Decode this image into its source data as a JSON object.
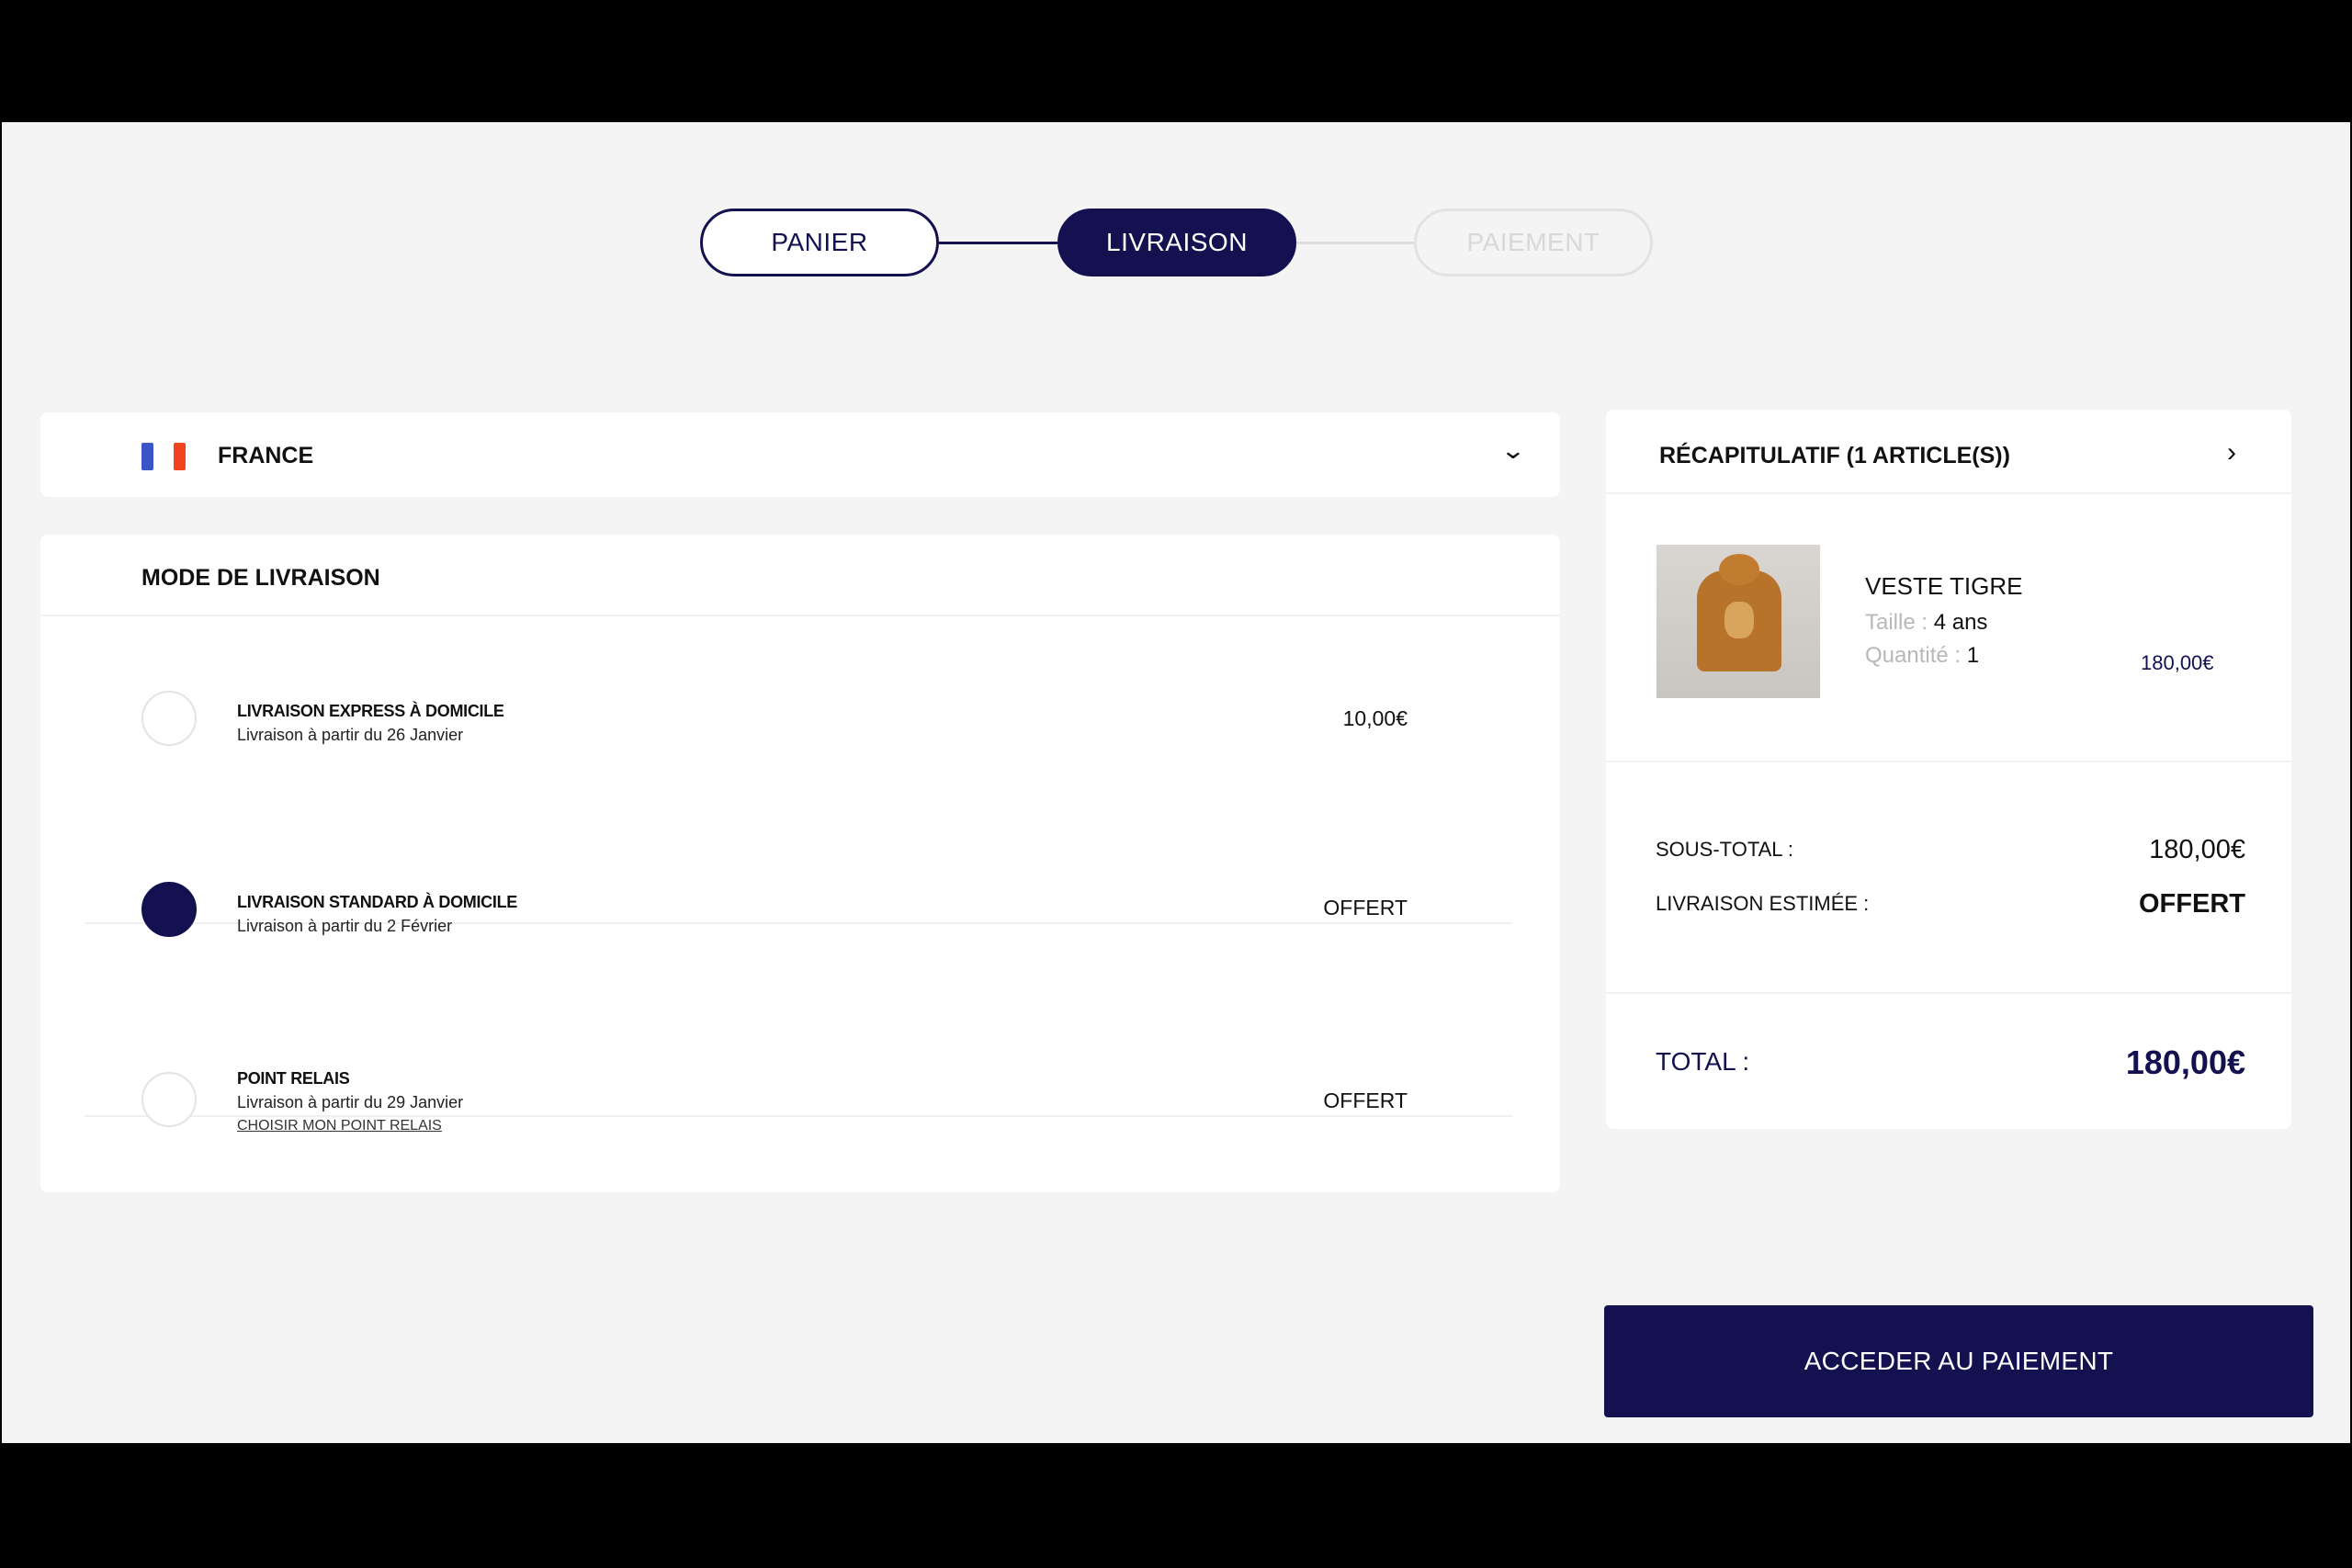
{
  "colors": {
    "accent": "#141150",
    "flag_blue": "#3b54c8",
    "flag_red": "#f0431e"
  },
  "stepper": {
    "steps": [
      {
        "label": "PANIER",
        "state": "done"
      },
      {
        "label": "LIVRAISON",
        "state": "active"
      },
      {
        "label": "PAIEMENT",
        "state": "todo"
      }
    ]
  },
  "country": {
    "name": "FRANCE",
    "flag_icon": "flag-france-icon",
    "toggle_icon": "chevron-down-icon"
  },
  "delivery": {
    "title": "MODE DE LIVRAISON",
    "options": [
      {
        "title": "LIVRAISON EXPRESS À DOMICILE",
        "subtitle": "Livraison à partir du 26 Janvier",
        "price": "10,00€",
        "selected": false
      },
      {
        "title": "LIVRAISON STANDARD À DOMICILE",
        "subtitle": "Livraison à partir du 2 Février",
        "price": "OFFERT",
        "selected": true
      },
      {
        "title": "POINT RELAIS",
        "subtitle": "Livraison à partir du 29 Janvier",
        "link": "CHOISIR MON POINT RELAIS",
        "price": "OFFERT",
        "selected": false
      }
    ]
  },
  "summary": {
    "title": "RÉCAPITULATIF (1 ARTICLE(S))",
    "expand_icon": "chevron-right-icon",
    "product": {
      "name": "VESTE TIGRE",
      "size_label": "Taille :",
      "size_value": "4 ans",
      "qty_label": "Quantité :",
      "qty_value": "1",
      "price": "180,00€"
    },
    "subtotal_label": "SOUS-TOTAL :",
    "subtotal_value": "180,00€",
    "shipping_label": "LIVRAISON ESTIMÉE :",
    "shipping_value": "OFFERT",
    "total_label": "TOTAL :",
    "total_value": "180,00€"
  },
  "pay_button": "ACCEDER AU PAIEMENT"
}
